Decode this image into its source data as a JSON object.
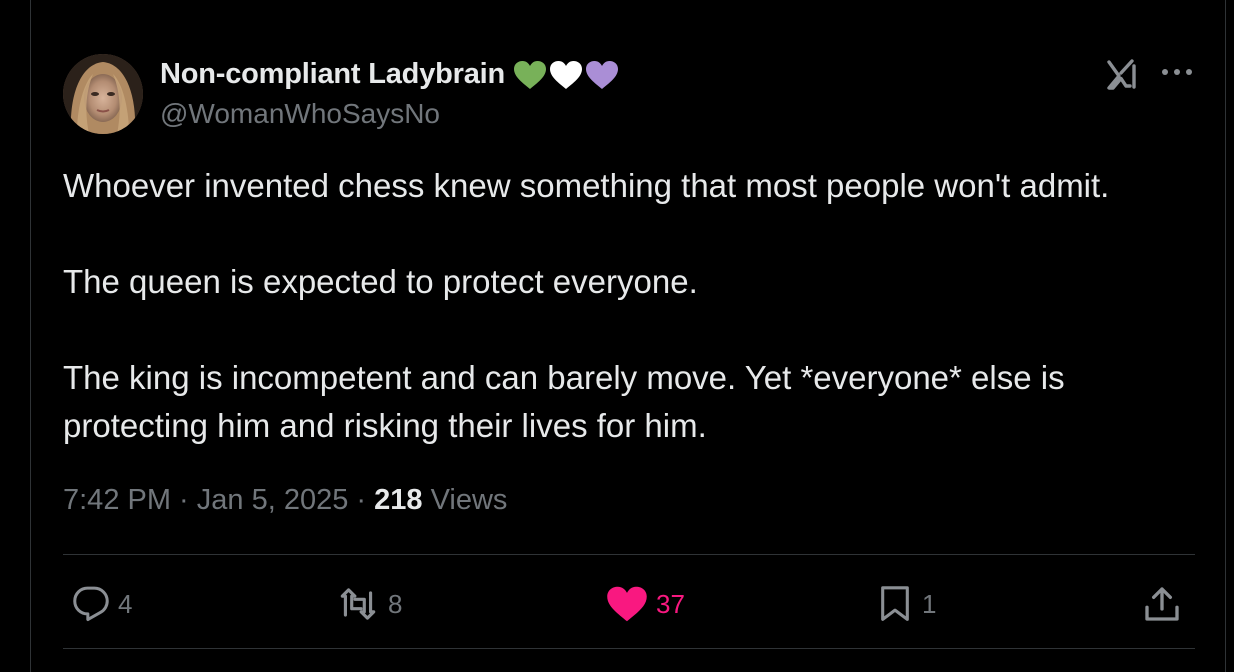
{
  "author": {
    "display_name": "Non-compliant Ladybrain",
    "handle": "@WomanWhoSaysNo",
    "name_emojis": [
      {
        "icon": "green-heart-icon",
        "color": "#78b159"
      },
      {
        "icon": "white-heart-icon",
        "color": "#ffffff"
      },
      {
        "icon": "purple-heart-icon",
        "color": "#aa8ed6"
      }
    ]
  },
  "header_icons": {
    "grok": "grok-icon",
    "more": "more-options-icon"
  },
  "tweet": {
    "paragraphs": [
      "Whoever invented chess knew something that most people won't admit.",
      "The queen is expected to protect everyone.",
      "The king is incompetent and can barely move. Yet *everyone* else is protecting him and risking their lives for him."
    ],
    "time": "7:42 PM",
    "separator": " · ",
    "date": "Jan 5, 2025",
    "views_count": "218",
    "views_label": " Views"
  },
  "actions": {
    "replies": {
      "icon": "reply-icon",
      "count": "4"
    },
    "reposts": {
      "icon": "repost-icon",
      "count": "8"
    },
    "likes": {
      "icon": "heart-icon",
      "count": "37",
      "color": "#f91880"
    },
    "bookmarks": {
      "icon": "bookmark-icon",
      "count": "1"
    },
    "share": {
      "icon": "share-icon"
    }
  },
  "colors": {
    "background": "#000000",
    "text_primary": "#e7e9ea",
    "text_secondary": "#71767b",
    "divider": "#2f3336",
    "like_pink": "#f91880"
  }
}
